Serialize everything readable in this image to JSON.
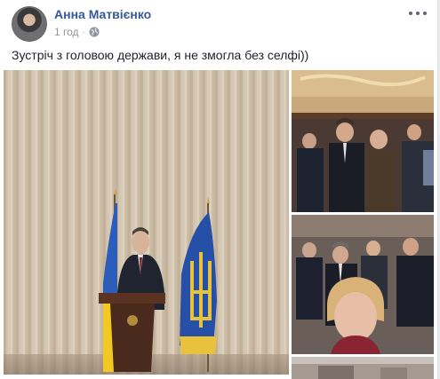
{
  "post": {
    "author": "Анна Матвієнко",
    "time": "1 год",
    "separator": "·",
    "text": "Зустріч з головою держави, я не змогла без селфі))",
    "icons": {
      "privacy": "globe-icon",
      "more": "more-options-icon"
    },
    "colors": {
      "author_link": "#365899",
      "meta": "#90949c",
      "text": "#1d2129",
      "background": "#e9ebee"
    }
  }
}
